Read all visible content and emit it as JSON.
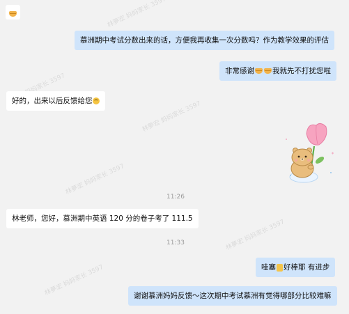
{
  "watermark_text": "林夢宏 妈妈家长 3597",
  "messages": {
    "m0_emoji": "handshake-emoji",
    "m1": "慕洲期中考试分数出来的话，方便我再收集一次分数吗？作为教学效果的评估",
    "m2_a": "非常感谢",
    "m2_b": "我就先不打扰您啦",
    "m3": "好的，出来以后反馈给您",
    "time1": "11:26",
    "m4": "林老师，您好，慕洲期中英语 120 分的卷子考了 111.5",
    "time2": "11:33",
    "m5_a": "哇塞",
    "m5_b": "好棒耶 有进步",
    "m6": "谢谢慕洲妈妈反馈～这次期中考试慕洲有觉得哪部分比较难嘛"
  },
  "sticker": {
    "name": "bear-holding-tulip-sticker"
  },
  "colors": {
    "background": "#f2f2f2",
    "incoming_bubble": "#ffffff",
    "outgoing_bubble": "#cfe4fb",
    "timestamp": "#9a9a9a"
  }
}
